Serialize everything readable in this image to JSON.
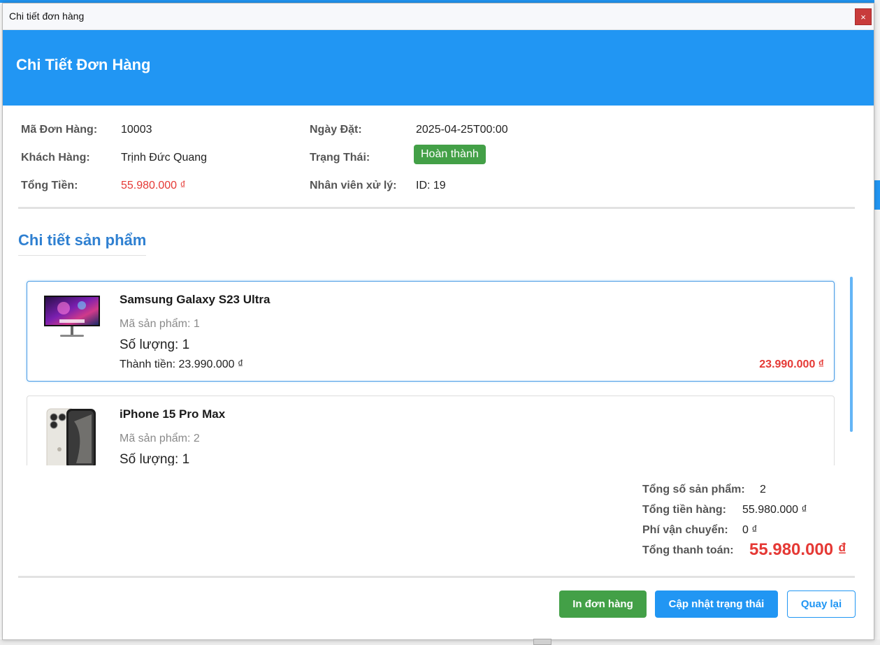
{
  "window": {
    "title": "Chi tiết đơn hàng",
    "close_glyph": "×"
  },
  "header": {
    "title": "Chi Tiết Đơn Hàng"
  },
  "order_info": {
    "order_id_label": "Mã Đơn Hàng:",
    "order_id": "10003",
    "order_date_label": "Ngày Đặt:",
    "order_date": "2025-04-25T00:00",
    "customer_label": "Khách Hàng:",
    "customer": "Trịnh Đức Quang",
    "status_label": "Trạng Thái:",
    "status": "Hoàn thành",
    "total_label": "Tổng Tiền:",
    "total": "55.980.000 ₫",
    "staff_label": "Nhân viên xử lý:",
    "staff": "ID: 19"
  },
  "products_section": {
    "title": "Chi tiết sản phẩm",
    "items": [
      {
        "name": "Samsung Galaxy S23 Ultra",
        "code": "Mã sản phẩm: 1",
        "quantity": "Số lượng: 1",
        "subtotal": "Thành tiền: 23.990.000 ₫",
        "price": "23.990.000 ₫",
        "image": "monitor-thumbnail",
        "selected": true
      },
      {
        "name": "iPhone 15 Pro Max",
        "code": "Mã sản phẩm: 2",
        "quantity": "Số lượng: 1",
        "image": "iphone-thumbnail",
        "selected": false
      }
    ]
  },
  "summary": {
    "count_label": "Tổng số sản phẩm:",
    "count": "2",
    "goods_label": "Tổng tiền hàng:",
    "goods": "55.980.000 ₫",
    "shipping_label": "Phí vận chuyển:",
    "shipping": "0 ₫",
    "grand_label": "Tổng thanh toán:",
    "grand": "55.980.000 ₫"
  },
  "buttons": {
    "print": "In đơn hàng",
    "update_status": "Cập nhật trạng thái",
    "back": "Quay lại"
  },
  "colors": {
    "primary": "#2196f3",
    "success": "#43a047",
    "danger": "#e53935"
  }
}
